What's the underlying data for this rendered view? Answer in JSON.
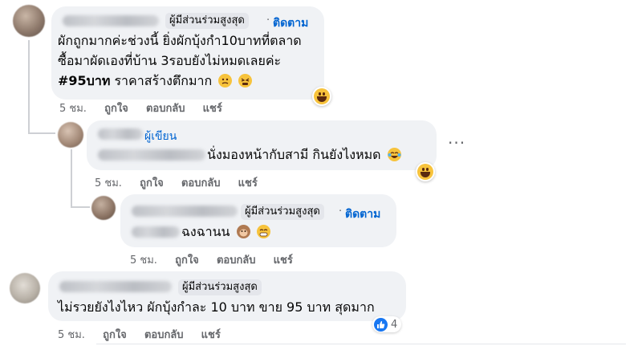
{
  "comments": [
    {
      "badge": "ผู้มีส่วนร่วมสูงสุด",
      "separator": "·",
      "follow": "ติดตาม",
      "lines": [
        "ผักถูกมากค่ะช่วงนี้ ยิ่งผักบุ้งกำ10บาทที่ตลาด",
        "ซื้อมาผัดเองที่บ้าน 3รอบยังไม่หมดเลยค่ะ"
      ],
      "hashtag": "#95บาท",
      "line3_rest": "ราคาสร้างตึกมาก",
      "time": "5 ชม.",
      "like": "ถูกใจ",
      "reply": "ตอบกลับ",
      "share": "แชร์"
    },
    {
      "badge": "ผู้เขียน",
      "text": "นั่งมองหน้ากับสามี กินยังไงหมด",
      "time": "5 ชม.",
      "like": "ถูกใจ",
      "reply": "ตอบกลับ",
      "share": "แชร์",
      "more": "···"
    },
    {
      "badge": "ผู้มีส่วนร่วมสูงสุด",
      "separator": "·",
      "follow": "ติดตาม",
      "text": "ฉงฉานน",
      "time": "5 ชม.",
      "like": "ถูกใจ",
      "reply": "ตอบกลับ",
      "share": "แชร์"
    },
    {
      "badge": "ผู้มีส่วนร่วมสูงสุด",
      "text": "ไม่รวยยังไงไหว ผักบุ้งกำละ 10 บาท ขาย 95 บาท สุดมาก",
      "time": "5 ชม.",
      "like": "ถูกใจ",
      "reply": "ตอบกลับ",
      "share": "แชร์",
      "like_count": "4"
    }
  ],
  "icons": [
    "laughing-face-icon",
    "grimace-face-icon",
    "tears-of-joy-icon",
    "monkey-face-icon",
    "grin-face-icon",
    "like-thumb-icon",
    "more-dots-icon"
  ],
  "colors": {
    "accent": "#0064d1",
    "bubble": "#f0f2f5",
    "muted": "#65676b",
    "like_blue": "#1877f2"
  }
}
